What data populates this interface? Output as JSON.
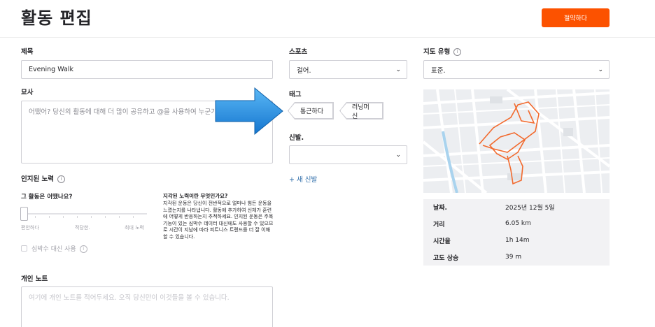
{
  "header": {
    "title": "활동 편집",
    "save_label": "절약하다"
  },
  "form": {
    "title_label": "제목",
    "title_value": "Evening Walk",
    "description_label": "묘사",
    "description_placeholder": "어땠어? 당신의 활동에 대해 더 많이 공유하고 @을 사용하여 누군가를 태그하세요.",
    "perceived_effort_label": "인지된 노력",
    "effort_question": "그 활동은 어땠나요?",
    "effort_scale": [
      "편안하다",
      "적당한.",
      "최대 노력"
    ],
    "effort_value": 0,
    "effort_explainer_title": "지각된 노력이란 무엇인가요?",
    "effort_explainer_body": "지각된 운동은 당신이 전반적으로 얼마나 힘든 운동을 느꼈는지를 나타냅니다. 활동에 추가하여 신체가 훈련에 어떻게 반응하는지 추적하세요. 인지된 운동은 주목 기능이 있는 심박수 데이터 대신에도 사용할 수 있으므로 시간이 지남에 따라 피트니스 트렌드를 더 잘 이해할 수 있습니다.",
    "use_instead_label": "심박수 대신 사용",
    "private_notes_label": "개인 노트",
    "private_notes_placeholder": "여기에 개인 노트를 적어두세요. 오직 당신만이 이것들을 볼 수 있습니다.",
    "sport_label": "스포츠",
    "sport_value": "걸어.",
    "tags_label": "태그",
    "tags": [
      "통근하다",
      "러닝머신"
    ],
    "shoes_label": "신발.",
    "shoes_value": "",
    "new_shoe_label": "+ 새 신발",
    "map_type_label": "지도 유형",
    "map_type_value": "표준."
  },
  "stats": [
    {
      "key": "날짜.",
      "value": "2025년 12월 5일"
    },
    {
      "key": "거리",
      "value": "6.05 km"
    },
    {
      "key": "시간을",
      "value": "1h 14m"
    },
    {
      "key": "고도 상승",
      "value": "39 m"
    }
  ],
  "colors": {
    "accent": "#fc5200",
    "arrow": "#1e90e6",
    "route": "#f26a2e",
    "link": "#2b6ba8"
  },
  "icons": {
    "info": "info-icon",
    "chevron": "chevron-down-icon",
    "arrow": "arrow-right-icon"
  }
}
